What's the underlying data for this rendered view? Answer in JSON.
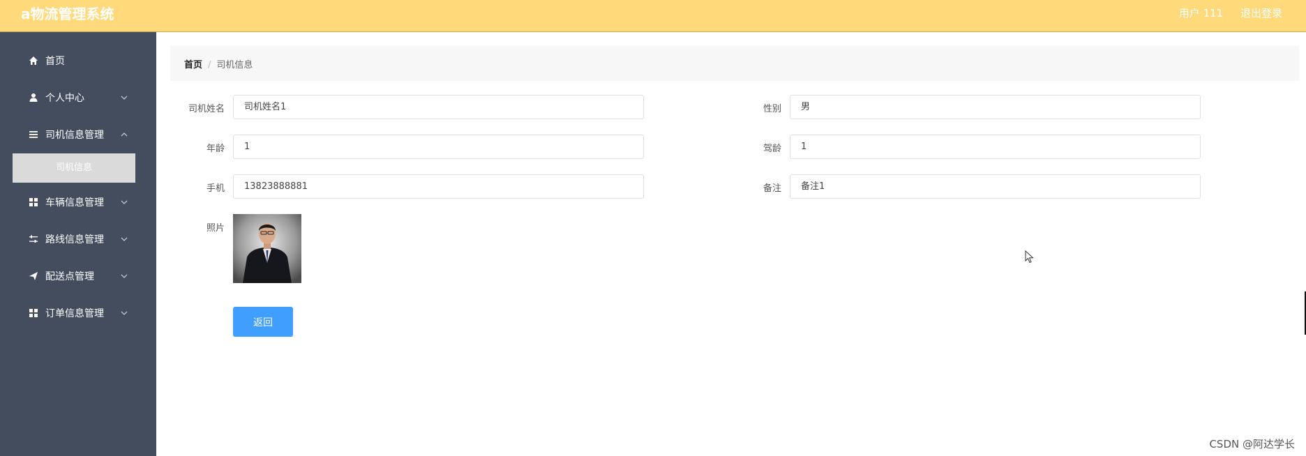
{
  "header": {
    "app_title": "a物流管理系统",
    "user_label": "用户 111",
    "logout_label": "退出登录"
  },
  "sidebar": {
    "items": [
      {
        "label": "首页",
        "icon": "home-icon"
      },
      {
        "label": "个人中心",
        "icon": "user-icon"
      },
      {
        "label": "司机信息管理",
        "icon": "list-icon"
      },
      {
        "label": "车辆信息管理",
        "icon": "grid-icon"
      },
      {
        "label": "路线信息管理",
        "icon": "sliders-icon"
      },
      {
        "label": "配送点管理",
        "icon": "send-icon"
      },
      {
        "label": "订单信息管理",
        "icon": "grid-icon"
      }
    ],
    "submenu_active": "司机信息"
  },
  "breadcrumb": {
    "home": "首页",
    "separator": "/",
    "current": "司机信息"
  },
  "form": {
    "driver_name_label": "司机姓名",
    "driver_name_value": "司机姓名1",
    "gender_label": "性别",
    "gender_value": "男",
    "age_label": "年龄",
    "age_value": "1",
    "driving_years_label": "驾龄",
    "driving_years_value": "1",
    "phone_label": "手机",
    "phone_value": "13823888881",
    "remark_label": "备注",
    "remark_value": "备注1",
    "photo_label": "照片",
    "back_label": "返回"
  },
  "watermark": "CSDN @阿达学长",
  "colors": {
    "topbar": "#ffd97a",
    "sidebar": "#444d5e",
    "active_submenu": "#dadada",
    "primary_button": "#409eff"
  }
}
